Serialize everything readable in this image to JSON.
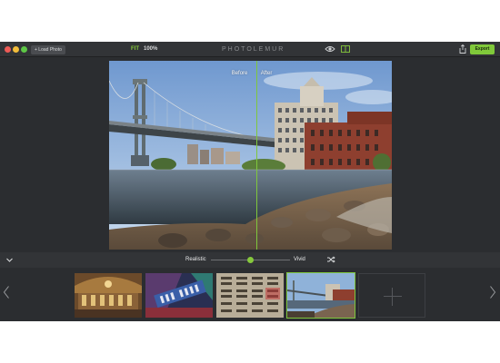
{
  "window": {
    "load_label": "+ Load Photo",
    "fit_label": "FIT",
    "zoom_value": "100%",
    "brand": "PHOTOLEMUR",
    "export_label": "Export",
    "traffic_colors": [
      "#ee5b56",
      "#f2bd3a",
      "#5ec746"
    ],
    "accent_color": "#80c93a"
  },
  "preview": {
    "before_label": "Before",
    "after_label": "After",
    "split_fraction": 0.52
  },
  "adjust": {
    "left_label": "Realistic",
    "right_label": "Vivid",
    "slider_value": 0.5
  },
  "icons": {
    "eye": "eye-icon",
    "compare": "split-view-icon",
    "share": "share-icon",
    "collapse": "chevron-down-icon",
    "shuffle": "shuffle-icon",
    "prev": "chevron-left-icon",
    "next": "chevron-right-icon",
    "add": "plus-icon"
  },
  "filmstrip": {
    "thumbnails": [
      {
        "name": "station-interior",
        "active": false
      },
      {
        "name": "new-york-sign",
        "active": false
      },
      {
        "name": "typography-grid",
        "active": false
      },
      {
        "name": "bridge-and-buildings",
        "active": true
      }
    ]
  }
}
